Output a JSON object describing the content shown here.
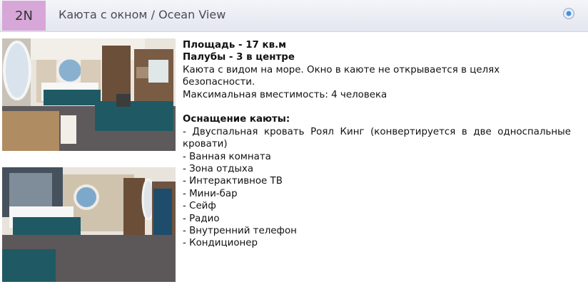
{
  "cabin": {
    "code": "2N",
    "title": "Каюта с окном / Ocean View"
  },
  "details": {
    "area": "Площадь - 17 кв.м",
    "decks": "Палубы - 3 в центре",
    "description": "Каюта с видом на море. Окно в каюте не открывается в целях безопасности.",
    "capacity": "Максимальная вместимость: 4 человека",
    "amenities_title": "Оснащение каюты:",
    "amenities": [
      "- Двуспальная кровать Роял Кинг (конвертируется в две односпальные кровати)",
      "- Ванная комната",
      "- Зона отдыха",
      "- Интерактивное ТВ",
      "- Мини-бар",
      "- Сейф",
      "- Радио",
      "- Внутренний телефон",
      "- Кондиционер"
    ]
  },
  "colors": {
    "badge": "#d7a7d8",
    "teal_upholstery": "#1f5a64",
    "header_gradient": "#e3e6ef"
  }
}
